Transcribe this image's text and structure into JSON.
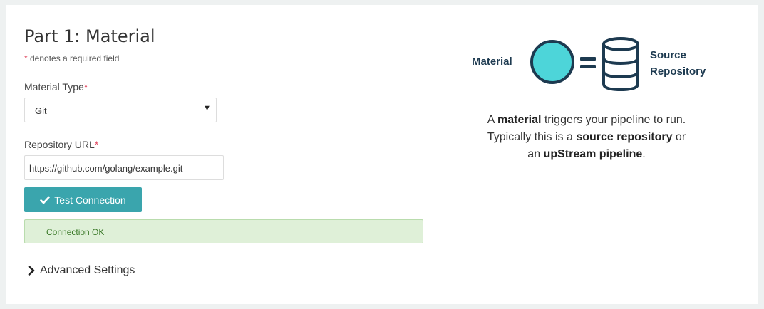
{
  "part": {
    "title": "Part 1: Material"
  },
  "required_note": {
    "star": "*",
    "text": " denotes a required field"
  },
  "material_type": {
    "label": "Material Type",
    "star": "*",
    "selected": "Git"
  },
  "repo_url": {
    "label": "Repository URL",
    "star": "*",
    "value": "https://github.com/golang/example.git"
  },
  "test_button": {
    "label": "Test Connection",
    "icon": "check-icon"
  },
  "status": {
    "message": "Connection OK",
    "color": "#dff0d8"
  },
  "advanced": {
    "label": "Advanced Settings",
    "icon": "chevron-right-icon"
  },
  "diagram": {
    "left_label": "Material",
    "right_label_line1": "Source",
    "right_label_line2": "Repository",
    "circle_color": "#4dd5d9",
    "stroke_color": "#1d3a50"
  },
  "description": {
    "p1": "A ",
    "b1": "material",
    "p2": " triggers your pipeline to run.",
    "p3": "Typically this is a ",
    "b2": "source repository",
    "p4": " or",
    "p5": "an ",
    "b3": "upStream pipeline",
    "p6": "."
  },
  "colors": {
    "accent": "#3aa5ad",
    "required": "#e0465e",
    "success_text": "#3c7a2a"
  }
}
